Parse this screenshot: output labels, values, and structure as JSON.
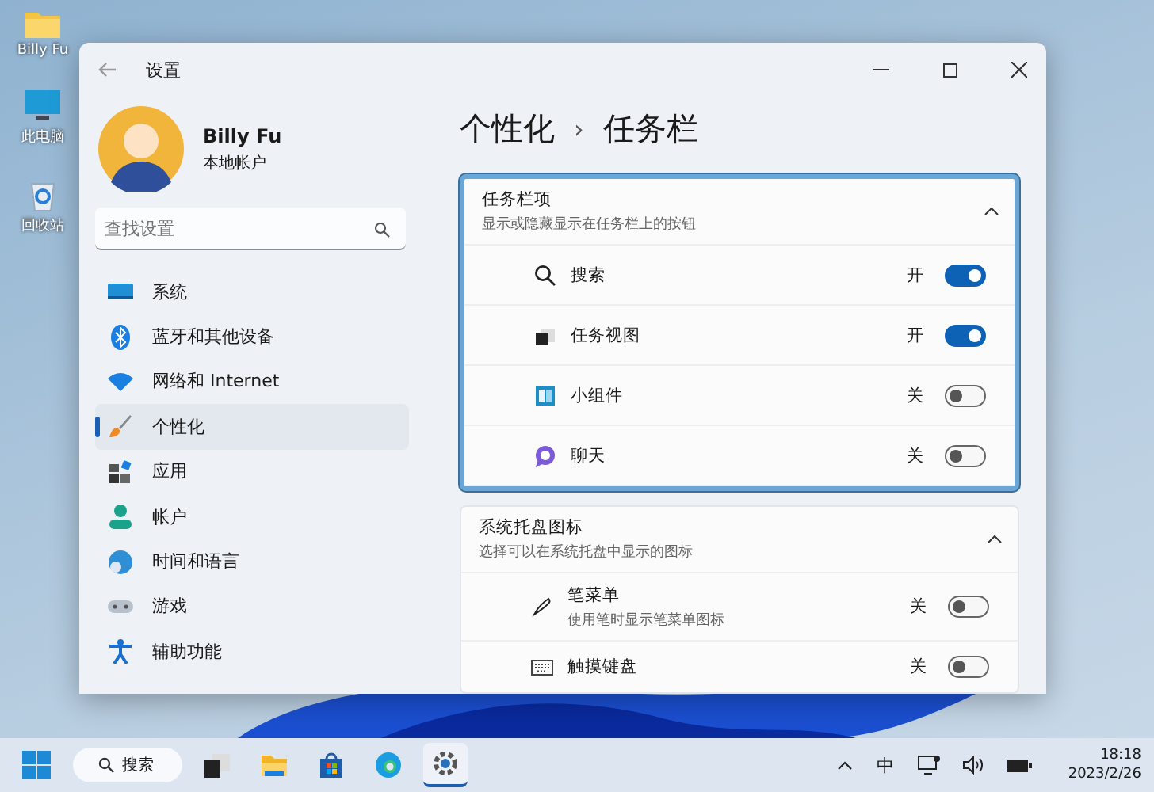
{
  "desktop_icons": [
    {
      "label": "Billy Fu"
    },
    {
      "label": "此电脑"
    },
    {
      "label": "回收站"
    }
  ],
  "window": {
    "title": "设置"
  },
  "profile": {
    "name": "Billy Fu",
    "account_type": "本地帐户"
  },
  "search": {
    "placeholder": "查找设置"
  },
  "nav_items": [
    {
      "label": "系统",
      "selected": false
    },
    {
      "label": "蓝牙和其他设备",
      "selected": false
    },
    {
      "label": "网络和 Internet",
      "selected": false
    },
    {
      "label": "个性化",
      "selected": true
    },
    {
      "label": "应用",
      "selected": false
    },
    {
      "label": "帐户",
      "selected": false
    },
    {
      "label": "时间和语言",
      "selected": false
    },
    {
      "label": "游戏",
      "selected": false
    },
    {
      "label": "辅助功能",
      "selected": false
    }
  ],
  "breadcrumb": {
    "parent": "个性化",
    "separator": "›",
    "current": "任务栏"
  },
  "sections": [
    {
      "title": "任务栏项",
      "subtitle": "显示或隐藏显示在任务栏上的按钮",
      "expanded": true,
      "highlighted": true,
      "items": [
        {
          "label": "搜索",
          "state_label": "开",
          "on": true
        },
        {
          "label": "任务视图",
          "state_label": "开",
          "on": true
        },
        {
          "label": "小组件",
          "state_label": "关",
          "on": false
        },
        {
          "label": "聊天",
          "state_label": "关",
          "on": false
        }
      ]
    },
    {
      "title": "系统托盘图标",
      "subtitle": "选择可以在系统托盘中显示的图标",
      "expanded": true,
      "highlighted": false,
      "items": [
        {
          "label": "笔菜单",
          "subtitle": "使用笔时显示笔菜单图标",
          "state_label": "关",
          "on": false
        },
        {
          "label": "触摸键盘",
          "state_label": "关",
          "on": false
        }
      ]
    }
  ],
  "taskbar": {
    "search_label": "搜索",
    "apps": [
      {
        "selected": false
      },
      {
        "selected": false
      },
      {
        "selected": false
      },
      {
        "selected": false
      },
      {
        "selected": true
      }
    ],
    "ime": "中",
    "time": "18:18",
    "date": "2023/2/26"
  }
}
